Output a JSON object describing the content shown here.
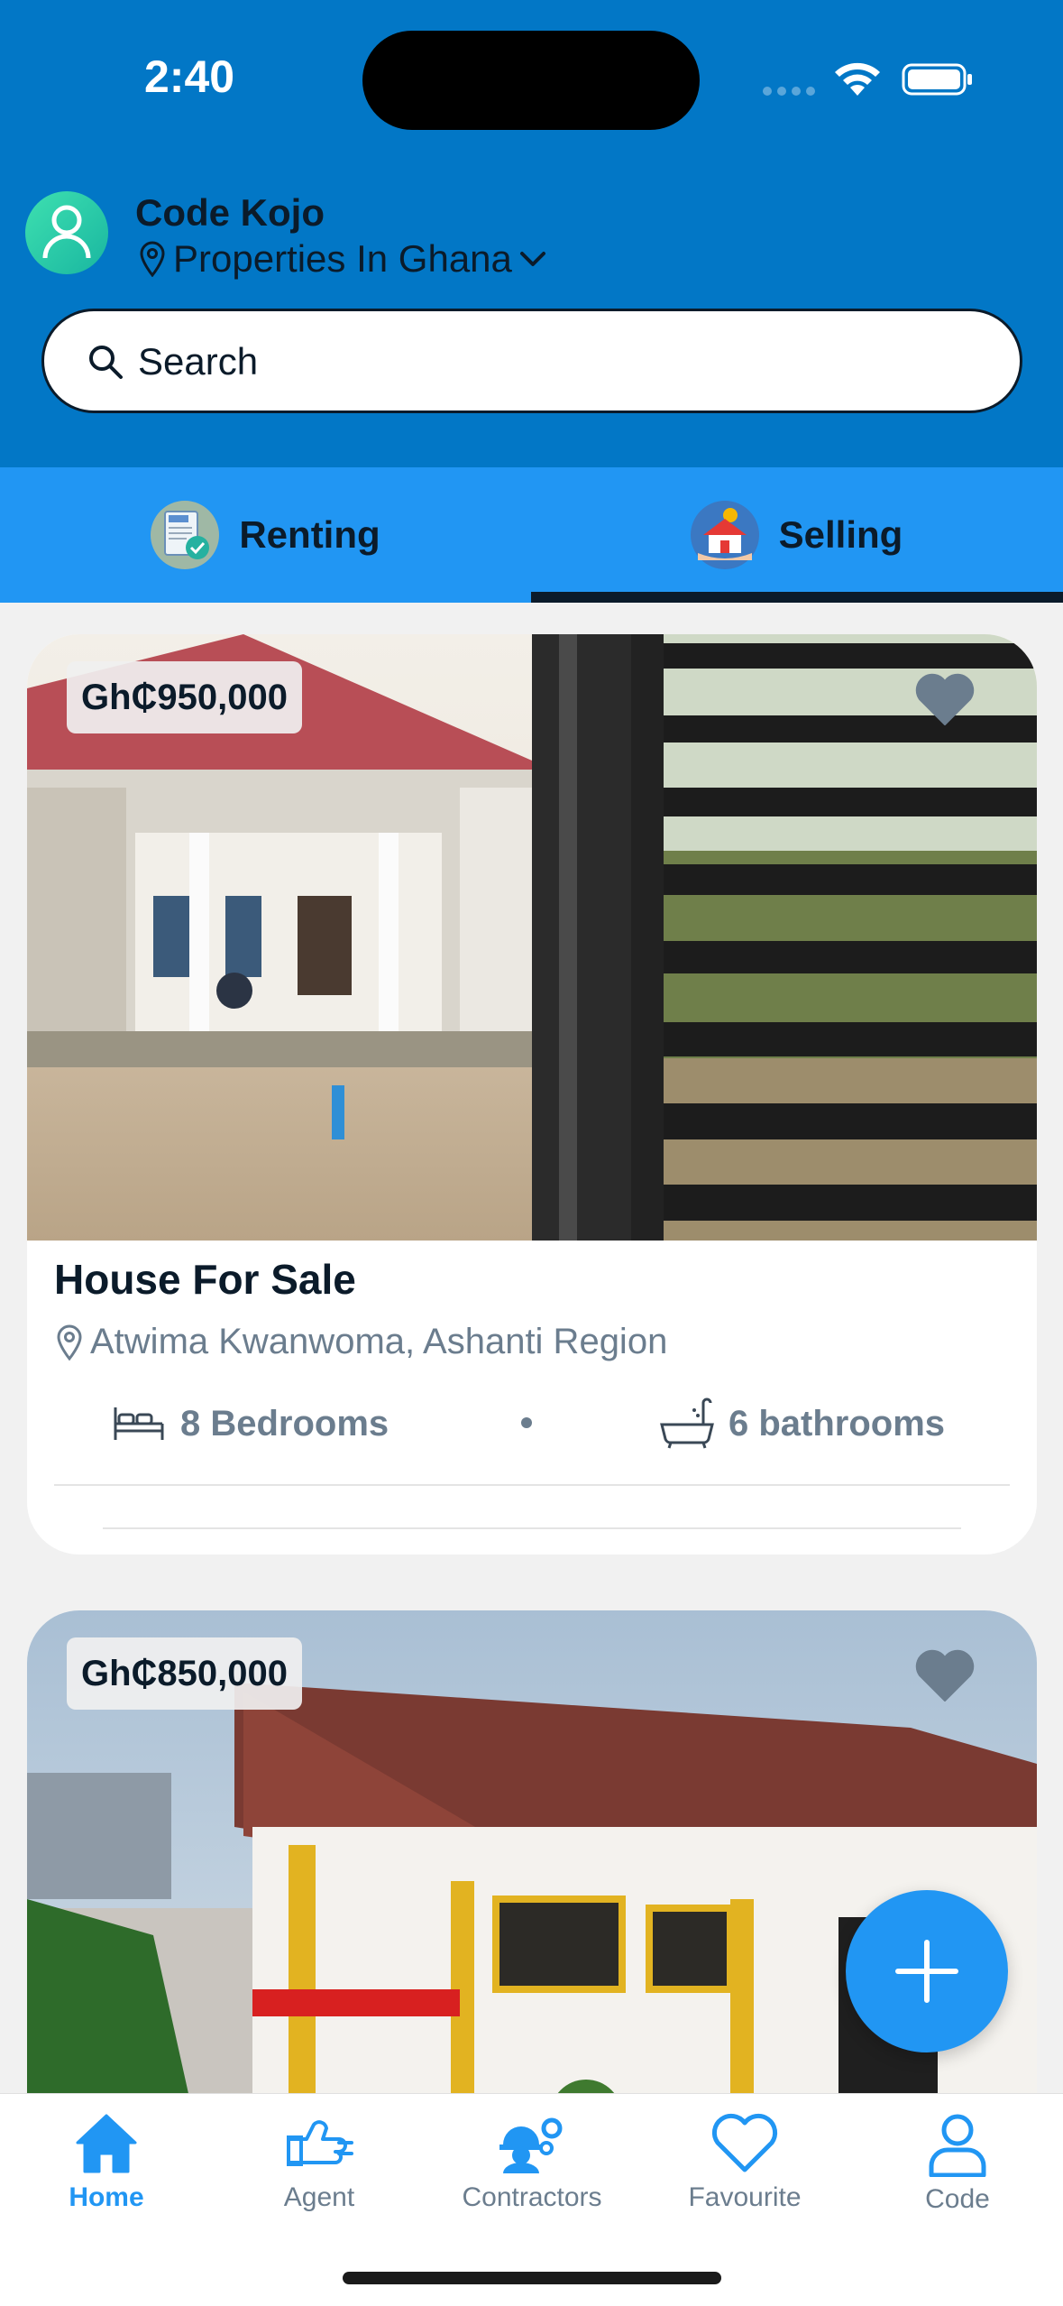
{
  "status_bar": {
    "time": "2:40"
  },
  "user": {
    "name": "Code Kojo",
    "location": "Properties In Ghana"
  },
  "search": {
    "placeholder": "Search"
  },
  "tabs": [
    {
      "label": "Renting",
      "icon": "rent-document-icon",
      "active": false
    },
    {
      "label": "Selling",
      "icon": "house-sale-icon",
      "active": true
    }
  ],
  "listings": [
    {
      "price": "Gh₵950,000",
      "title": "House For Sale",
      "location": "Atwima Kwanwoma, Ashanti Region",
      "bedrooms": "8 Bedrooms",
      "bathrooms": "6 bathrooms",
      "favourite": false
    },
    {
      "price": "Gh₵850,000",
      "favourite": false
    }
  ],
  "nav": [
    {
      "label": "Home",
      "icon": "home-icon",
      "active": true
    },
    {
      "label": "Agent",
      "icon": "agent-icon",
      "active": false
    },
    {
      "label": "Contractors",
      "icon": "contractors-icon",
      "active": false
    },
    {
      "label": "Favourite",
      "icon": "heart-outline-icon",
      "active": false
    },
    {
      "label": "Code",
      "icon": "person-icon",
      "active": false
    }
  ],
  "colors": {
    "header": "#0277c6",
    "tabs": "#2196f3",
    "accent": "#2196f3",
    "text_dark": "#0b1b2a",
    "text_muted": "#6b7d8e"
  }
}
